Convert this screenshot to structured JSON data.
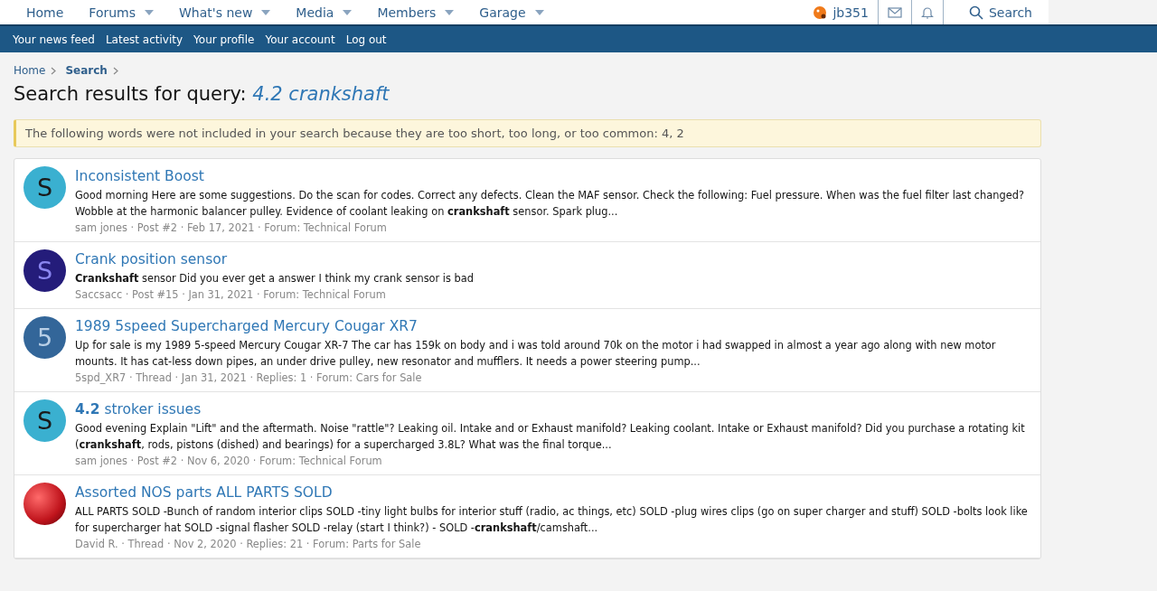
{
  "nav": {
    "items": [
      {
        "label": "Home",
        "dropdown": false
      },
      {
        "label": "Forums",
        "dropdown": true
      },
      {
        "label": "What's new",
        "dropdown": true
      },
      {
        "label": "Media",
        "dropdown": true
      },
      {
        "label": "Members",
        "dropdown": true
      },
      {
        "label": "Garage",
        "dropdown": true
      }
    ],
    "user": "jb351",
    "search": "Search"
  },
  "subnav": [
    "Your news feed",
    "Latest activity",
    "Your profile",
    "Your account",
    "Log out"
  ],
  "breadcrumb": [
    {
      "label": "Home",
      "current": false
    },
    {
      "label": "Search",
      "current": true
    }
  ],
  "title": {
    "prefix": "Search results for query:",
    "query": "4.2 crankshaft"
  },
  "notice": "The following words were not included in your search because they are too short, too long, or too common: 4, 2",
  "results": [
    {
      "avatar": {
        "kind": "letter",
        "letter": "S",
        "color": "#3ab0d0"
      },
      "title": "Inconsistent Boost",
      "snippet": "Good morning Here are some suggestions. Do the scan for codes. Correct any defects. Clean the MAF sensor. Check the following: Fuel pressure. When was the fuel filter last changed? Wobble at the harmonic balancer pulley. Evidence of coolant leaking on **crankshaft** sensor. Spark plug...",
      "meta": "sam jones · Post #2 · Feb 17, 2021 · Forum: Technical Forum"
    },
    {
      "avatar": {
        "kind": "letter",
        "letter": "S",
        "color": "#241c7a"
      },
      "title": "Crank position sensor",
      "snippet": "**Crankshaft** sensor Did you ever get a answer I think my crank sensor is bad",
      "meta": "Saccsacc · Post #15 · Jan 31, 2021 · Forum: Technical Forum"
    },
    {
      "avatar": {
        "kind": "letter",
        "letter": "5",
        "color": "#336699"
      },
      "title": "1989 5speed Supercharged Mercury Cougar XR7",
      "snippet": "Up for sale is my 1989 5-speed Mercury Cougar XR-7 The car has 159k on body and i was told around 70k on the motor i had swapped in almost a year ago along with new motor mounts. It has cat-less down pipes, an under drive pulley, new resonator and mufflers. It needs a power steering pump...",
      "meta": "5spd_XR7 · Thread · Jan 31, 2021 · Replies: 1 · Forum: Cars for Sale"
    },
    {
      "avatar": {
        "kind": "letter",
        "letter": "S",
        "color": "#3ab0d0"
      },
      "title": "**4.2** stroker issues",
      "snippet": "Good evening Explain \"Lift\" and the aftermath. Noise \"rattle\"? Leaking oil. Intake and or Exhaust manifold? Leaking coolant. Intake or Exhaust manifold? Did you purchase a rotating kit (**crankshaft**, rods, pistons (dished) and bearings) for a supercharged 3.8L? What was the final torque...",
      "meta": "sam jones · Post #2 · Nov 6, 2020 · Forum: Technical Forum"
    },
    {
      "avatar": {
        "kind": "photo",
        "color": "#c0141c"
      },
      "title": "Assorted NOS parts ALL PARTS SOLD",
      "snippet": "ALL PARTS SOLD -Bunch of random interior clips SOLD -tiny light bulbs for interior stuff (radio, ac things, etc) SOLD -plug wires clips (go on super charger and stuff) SOLD -bolts look like for supercharger hat SOLD -signal flasher SOLD -relay (start I think?) - SOLD -**crankshaft**/camshaft...",
      "meta": "David R. · Thread · Nov 2, 2020 · Replies: 21 · Forum: Parts for Sale"
    }
  ]
}
